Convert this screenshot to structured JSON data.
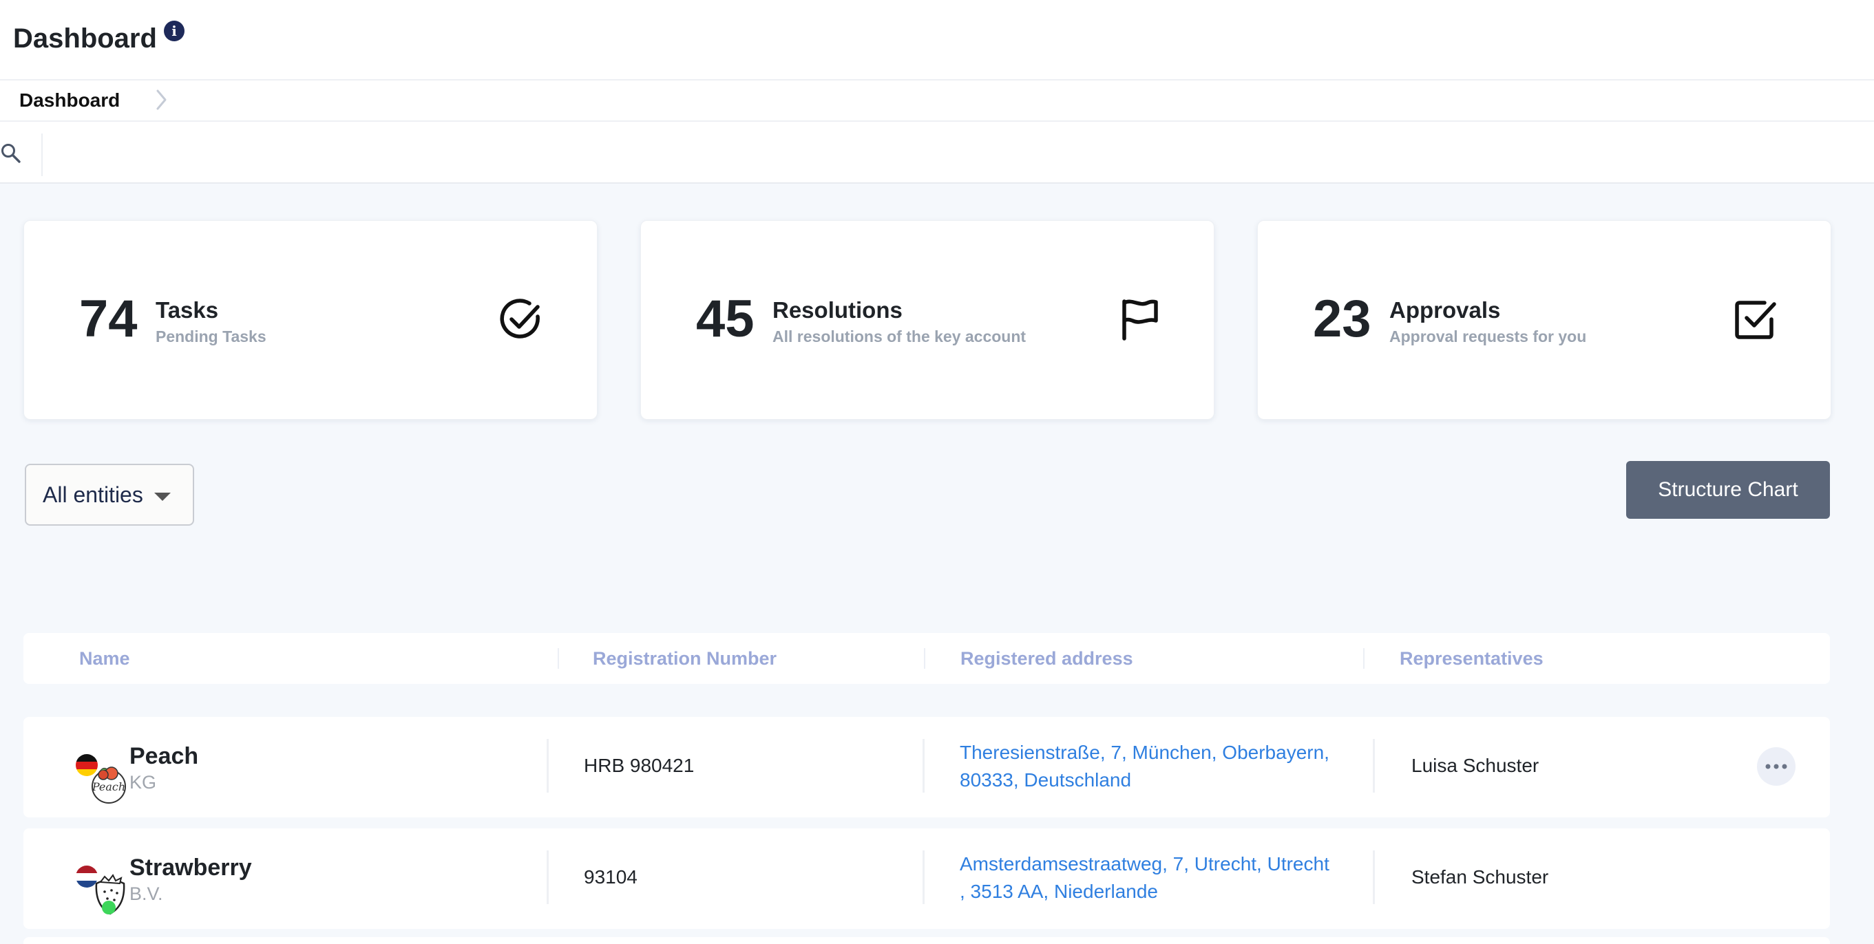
{
  "header": {
    "title": "Dashboard"
  },
  "breadcrumb": {
    "items": [
      "Dashboard"
    ]
  },
  "search": {
    "placeholder": ""
  },
  "stats": [
    {
      "number": "74",
      "label": "Tasks",
      "sublabel": "Pending Tasks",
      "icon": "check-circle-icon"
    },
    {
      "number": "45",
      "label": "Resolutions",
      "sublabel": "All resolutions of the key account",
      "icon": "flag-icon"
    },
    {
      "number": "23",
      "label": "Approvals",
      "sublabel": "Approval requests for you",
      "icon": "checkbox-icon"
    }
  ],
  "controls": {
    "entity_filter": "All entities",
    "structure_chart_label": "Structure Chart"
  },
  "table": {
    "columns": [
      "Name",
      "Registration Number",
      "Registered address",
      "Representatives"
    ],
    "rows": [
      {
        "name": "Peach",
        "type": "KG",
        "logo_text": "Peach",
        "registration": "HRB 980421",
        "address_line1": "Theresienstraße, 7, München, Oberbayern,",
        "address_line2": "80333, Deutschland",
        "representative": "Luisa Schuster",
        "country_flag": "germany-flag-icon",
        "status_color": "#3dd65a"
      },
      {
        "name": "Strawberry",
        "type": "B.V.",
        "registration": "93104",
        "address_line1": "Amsterdamsestraatweg, 7, Utrecht, Utrecht",
        "address_line2": ", 3513 AA, Niederlande",
        "representative": "Stefan Schuster",
        "country_flag": "netherlands-flag-icon",
        "status_color": "#3dd65a"
      }
    ]
  },
  "colors": {
    "link": "#2f7fe0",
    "header_text": "#9aa8d8",
    "button_bg": "#5b6679",
    "status_active": "#3dd65a",
    "info_icon": "#1e2a5a"
  }
}
